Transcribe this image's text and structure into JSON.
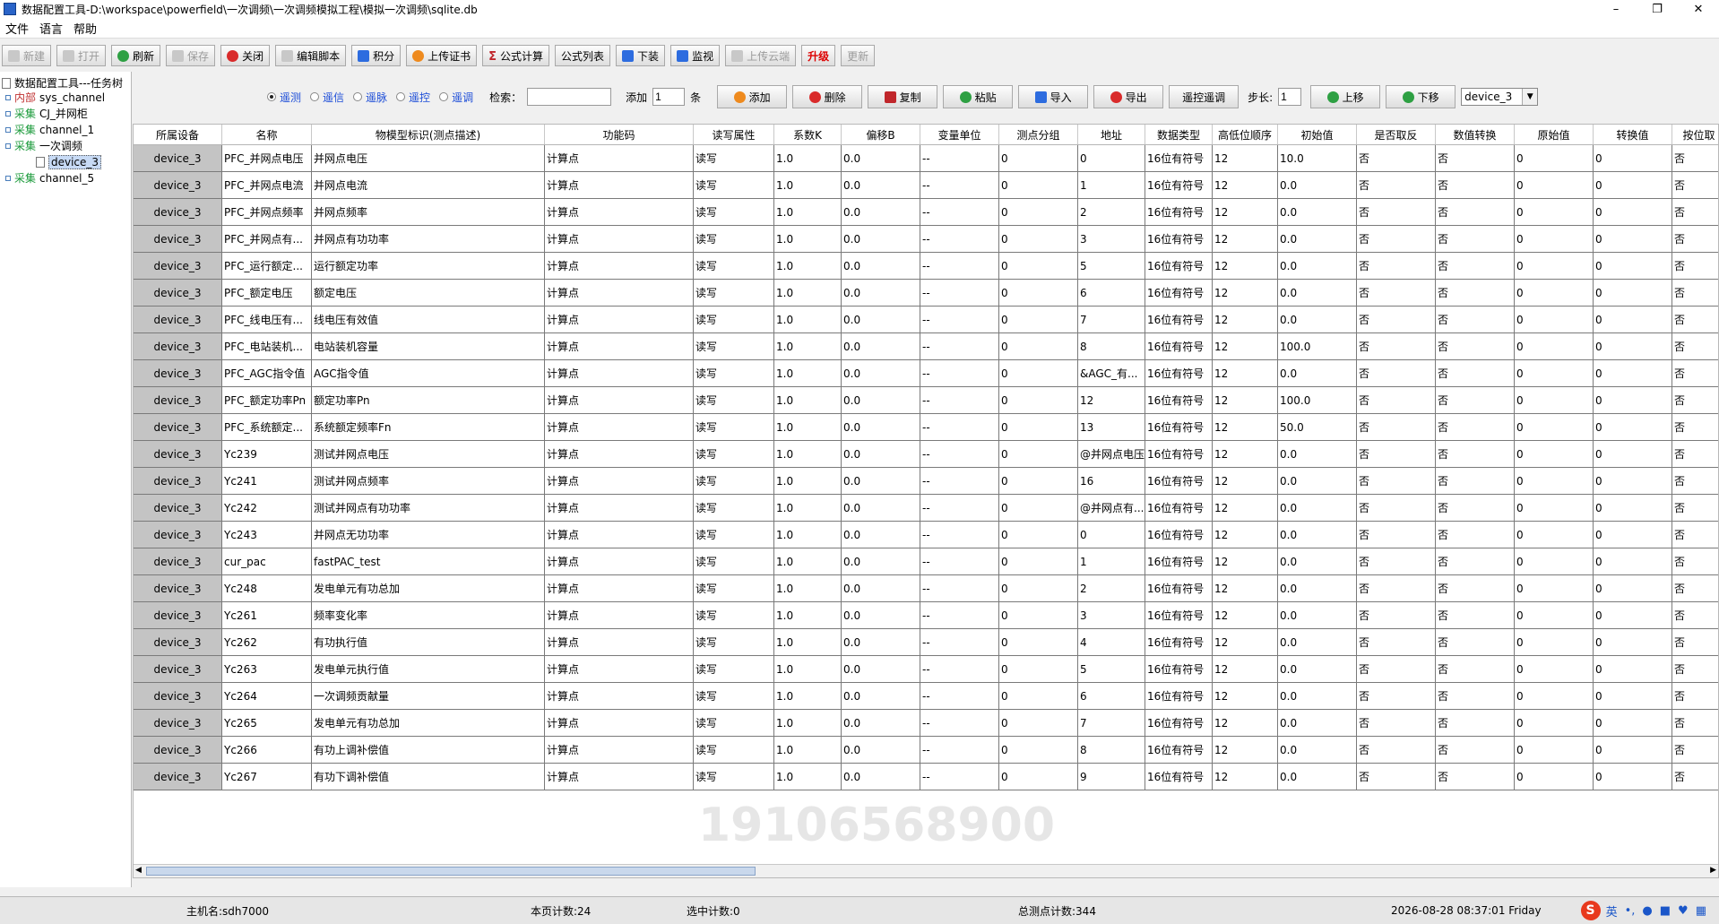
{
  "window": {
    "title": "数据配置工具-D:\\workspace\\powerfield\\一次调频\\一次调频模拟工程\\模拟一次调频\\sqlite.db",
    "min": "–",
    "max": "❐",
    "close": "✕"
  },
  "menu": [
    "文件",
    "语言",
    "帮助"
  ],
  "toolbar": [
    {
      "label": "新建",
      "icon": "grey",
      "disabled": true
    },
    {
      "label": "打开",
      "icon": "grey",
      "disabled": true
    },
    {
      "label": "刷新",
      "icon": "green",
      "disabled": false
    },
    {
      "label": "保存",
      "icon": "grey",
      "disabled": true
    },
    {
      "label": "关闭",
      "icon": "red",
      "disabled": false
    },
    {
      "label": "编辑脚本",
      "icon": "grey",
      "disabled": false
    },
    {
      "label": "积分",
      "icon": "blue",
      "disabled": false
    },
    {
      "label": "上传证书",
      "icon": "orange",
      "disabled": false
    },
    {
      "label": "公式计算",
      "icon": "sigma",
      "disabled": false
    },
    {
      "label": "公式列表",
      "icon": "",
      "disabled": false
    },
    {
      "label": "下装",
      "icon": "blue",
      "disabled": false
    },
    {
      "label": "监视",
      "icon": "blue",
      "disabled": false
    },
    {
      "label": "上传云端",
      "icon": "grey",
      "disabled": true
    },
    {
      "label": "升级",
      "icon": "",
      "disabled": false,
      "upgrade": true
    },
    {
      "label": "更新",
      "icon": "",
      "disabled": true
    }
  ],
  "tree": {
    "root": "数据配置工具---任务树",
    "nodes": [
      {
        "kind": "内部",
        "name": "sys_channel",
        "type": "in"
      },
      {
        "kind": "采集",
        "name": "CJ_并网柜",
        "type": "cj"
      },
      {
        "kind": "采集",
        "name": "channel_1",
        "type": "cj"
      },
      {
        "kind": "采集",
        "name": "一次调频",
        "type": "cj"
      },
      {
        "kind": "",
        "name": "device_3",
        "type": "leaf"
      },
      {
        "kind": "采集",
        "name": "channel_5",
        "type": "cj"
      }
    ]
  },
  "filter": {
    "radios": [
      {
        "label": "遥测",
        "on": true
      },
      {
        "label": "遥信",
        "on": false
      },
      {
        "label": "遥脉",
        "on": false
      },
      {
        "label": "遥控",
        "on": false
      },
      {
        "label": "遥调",
        "on": false
      }
    ],
    "search_label": "检索：",
    "search_value": "",
    "add_label": "添加",
    "add_count": "1",
    "add_unit": "条",
    "buttons": [
      "添加",
      "删除",
      "复制",
      "粘贴",
      "导入",
      "导出",
      "遥控遥调"
    ],
    "step_label": "步长:",
    "step_value": "1",
    "up": "上移",
    "down": "下移",
    "device_select": "device_3"
  },
  "table": {
    "columns": [
      "所属设备",
      "名称",
      "物模型标识(测点描述)",
      "功能码",
      "读写属性",
      "系数K",
      "偏移B",
      "变量单位",
      "测点分组",
      "地址",
      "数据类型",
      "高低位顺序",
      "初始值",
      "是否取反",
      "数值转换",
      "原始值",
      "转换值",
      "按位取"
    ],
    "rows": [
      [
        "device_3",
        "PFC_并网点电压",
        "并网点电压",
        "计算点",
        "读写",
        "1.0",
        "0.0",
        "--",
        "0",
        "0",
        "16位有符号",
        "12",
        "10.0",
        "否",
        "否",
        "0",
        "0",
        "否"
      ],
      [
        "device_3",
        "PFC_并网点电流",
        "并网点电流",
        "计算点",
        "读写",
        "1.0",
        "0.0",
        "--",
        "0",
        "1",
        "16位有符号",
        "12",
        "0.0",
        "否",
        "否",
        "0",
        "0",
        "否"
      ],
      [
        "device_3",
        "PFC_并网点频率",
        "并网点频率",
        "计算点",
        "读写",
        "1.0",
        "0.0",
        "--",
        "0",
        "2",
        "16位有符号",
        "12",
        "0.0",
        "否",
        "否",
        "0",
        "0",
        "否"
      ],
      [
        "device_3",
        "PFC_并网点有...",
        "并网点有功功率",
        "计算点",
        "读写",
        "1.0",
        "0.0",
        "--",
        "0",
        "3",
        "16位有符号",
        "12",
        "0.0",
        "否",
        "否",
        "0",
        "0",
        "否"
      ],
      [
        "device_3",
        "PFC_运行额定...",
        "运行额定功率",
        "计算点",
        "读写",
        "1.0",
        "0.0",
        "--",
        "0",
        "5",
        "16位有符号",
        "12",
        "0.0",
        "否",
        "否",
        "0",
        "0",
        "否"
      ],
      [
        "device_3",
        "PFC_额定电压",
        "额定电压",
        "计算点",
        "读写",
        "1.0",
        "0.0",
        "--",
        "0",
        "6",
        "16位有符号",
        "12",
        "0.0",
        "否",
        "否",
        "0",
        "0",
        "否"
      ],
      [
        "device_3",
        "PFC_线电压有...",
        "线电压有效值",
        "计算点",
        "读写",
        "1.0",
        "0.0",
        "--",
        "0",
        "7",
        "16位有符号",
        "12",
        "0.0",
        "否",
        "否",
        "0",
        "0",
        "否"
      ],
      [
        "device_3",
        "PFC_电站装机...",
        "电站装机容量",
        "计算点",
        "读写",
        "1.0",
        "0.0",
        "--",
        "0",
        "8",
        "16位有符号",
        "12",
        "100.0",
        "否",
        "否",
        "0",
        "0",
        "否"
      ],
      [
        "device_3",
        "PFC_AGC指令值",
        "AGC指令值",
        "计算点",
        "读写",
        "1.0",
        "0.0",
        "--",
        "0",
        "&AGC_有...",
        "16位有符号",
        "12",
        "0.0",
        "否",
        "否",
        "0",
        "0",
        "否"
      ],
      [
        "device_3",
        "PFC_额定功率Pn",
        "额定功率Pn",
        "计算点",
        "读写",
        "1.0",
        "0.0",
        "--",
        "0",
        "12",
        "16位有符号",
        "12",
        "100.0",
        "否",
        "否",
        "0",
        "0",
        "否"
      ],
      [
        "device_3",
        "PFC_系统额定...",
        "系统额定频率Fn",
        "计算点",
        "读写",
        "1.0",
        "0.0",
        "--",
        "0",
        "13",
        "16位有符号",
        "12",
        "50.0",
        "否",
        "否",
        "0",
        "0",
        "否"
      ],
      [
        "device_3",
        "Yc239",
        "测试并网点电压",
        "计算点",
        "读写",
        "1.0",
        "0.0",
        "--",
        "0",
        "@并网点电压",
        "16位有符号",
        "12",
        "0.0",
        "否",
        "否",
        "0",
        "0",
        "否"
      ],
      [
        "device_3",
        "Yc241",
        "测试并网点频率",
        "计算点",
        "读写",
        "1.0",
        "0.0",
        "--",
        "0",
        "16",
        "16位有符号",
        "12",
        "0.0",
        "否",
        "否",
        "0",
        "0",
        "否"
      ],
      [
        "device_3",
        "Yc242",
        "测试并网点有功功率",
        "计算点",
        "读写",
        "1.0",
        "0.0",
        "--",
        "0",
        "@并网点有...",
        "16位有符号",
        "12",
        "0.0",
        "否",
        "否",
        "0",
        "0",
        "否"
      ],
      [
        "device_3",
        "Yc243",
        "并网点无功功率",
        "计算点",
        "读写",
        "1.0",
        "0.0",
        "--",
        "0",
        "0",
        "16位有符号",
        "12",
        "0.0",
        "否",
        "否",
        "0",
        "0",
        "否"
      ],
      [
        "device_3",
        "cur_pac",
        "fastPAC_test",
        "计算点",
        "读写",
        "1.0",
        "0.0",
        "--",
        "0",
        "1",
        "16位有符号",
        "12",
        "0.0",
        "否",
        "否",
        "0",
        "0",
        "否"
      ],
      [
        "device_3",
        "Yc248",
        "发电单元有功总加",
        "计算点",
        "读写",
        "1.0",
        "0.0",
        "--",
        "0",
        "2",
        "16位有符号",
        "12",
        "0.0",
        "否",
        "否",
        "0",
        "0",
        "否"
      ],
      [
        "device_3",
        "Yc261",
        "频率变化率",
        "计算点",
        "读写",
        "1.0",
        "0.0",
        "--",
        "0",
        "3",
        "16位有符号",
        "12",
        "0.0",
        "否",
        "否",
        "0",
        "0",
        "否"
      ],
      [
        "device_3",
        "Yc262",
        "有功执行值",
        "计算点",
        "读写",
        "1.0",
        "0.0",
        "--",
        "0",
        "4",
        "16位有符号",
        "12",
        "0.0",
        "否",
        "否",
        "0",
        "0",
        "否"
      ],
      [
        "device_3",
        "Yc263",
        "发电单元执行值",
        "计算点",
        "读写",
        "1.0",
        "0.0",
        "--",
        "0",
        "5",
        "16位有符号",
        "12",
        "0.0",
        "否",
        "否",
        "0",
        "0",
        "否"
      ],
      [
        "device_3",
        "Yc264",
        "一次调频贡献量",
        "计算点",
        "读写",
        "1.0",
        "0.0",
        "--",
        "0",
        "6",
        "16位有符号",
        "12",
        "0.0",
        "否",
        "否",
        "0",
        "0",
        "否"
      ],
      [
        "device_3",
        "Yc265",
        "发电单元有功总加",
        "计算点",
        "读写",
        "1.0",
        "0.0",
        "--",
        "0",
        "7",
        "16位有符号",
        "12",
        "0.0",
        "否",
        "否",
        "0",
        "0",
        "否"
      ],
      [
        "device_3",
        "Yc266",
        "有功上调补偿值",
        "计算点",
        "读写",
        "1.0",
        "0.0",
        "--",
        "0",
        "8",
        "16位有符号",
        "12",
        "0.0",
        "否",
        "否",
        "0",
        "0",
        "否"
      ],
      [
        "device_3",
        "Yc267",
        "有功下调补偿值",
        "计算点",
        "读写",
        "1.0",
        "0.0",
        "--",
        "0",
        "9",
        "16位有符号",
        "12",
        "0.0",
        "否",
        "否",
        "0",
        "0",
        "否"
      ]
    ]
  },
  "watermark": "19106568900",
  "status": {
    "host": "主机名:sdh7000",
    "page_count": "本页计数:24",
    "selected": "选中计数:0",
    "total": "总测点计数:344",
    "datetime": "2026-08-28 08:37:01 Friday"
  },
  "tray": {
    "ime": "S",
    "lang": "英"
  }
}
